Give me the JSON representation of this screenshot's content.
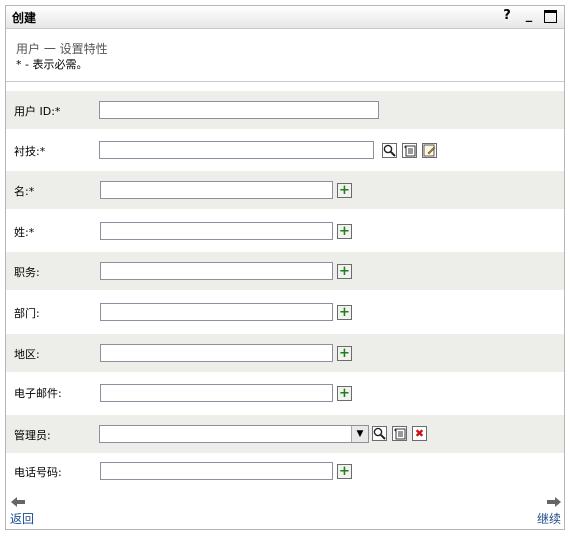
{
  "window": {
    "title": "创建",
    "help_label": "?",
    "minimize_label": "_"
  },
  "heading": "用户  一  设置特性",
  "required_note": "* - 表示必需。",
  "fields": {
    "user_id": {
      "label": "用户  ID:*",
      "value": ""
    },
    "context": {
      "label": "衬技:*",
      "value": ""
    },
    "first_name": {
      "label": "名:*",
      "value": ""
    },
    "last_name": {
      "label": "姓:*",
      "value": ""
    },
    "title": {
      "label": "职务:",
      "value": ""
    },
    "department": {
      "label": "部门:",
      "value": ""
    },
    "region": {
      "label": "地区:",
      "value": ""
    },
    "email": {
      "label": "电子邮件:",
      "value": ""
    },
    "manager": {
      "label": "管理员:",
      "value": ""
    },
    "phone": {
      "label": "电话号码:",
      "value": ""
    }
  },
  "icons": {
    "add": "+",
    "remove": "✖",
    "dropdown": "▼"
  },
  "nav": {
    "back_label": "返回",
    "continue_label": "继续"
  }
}
